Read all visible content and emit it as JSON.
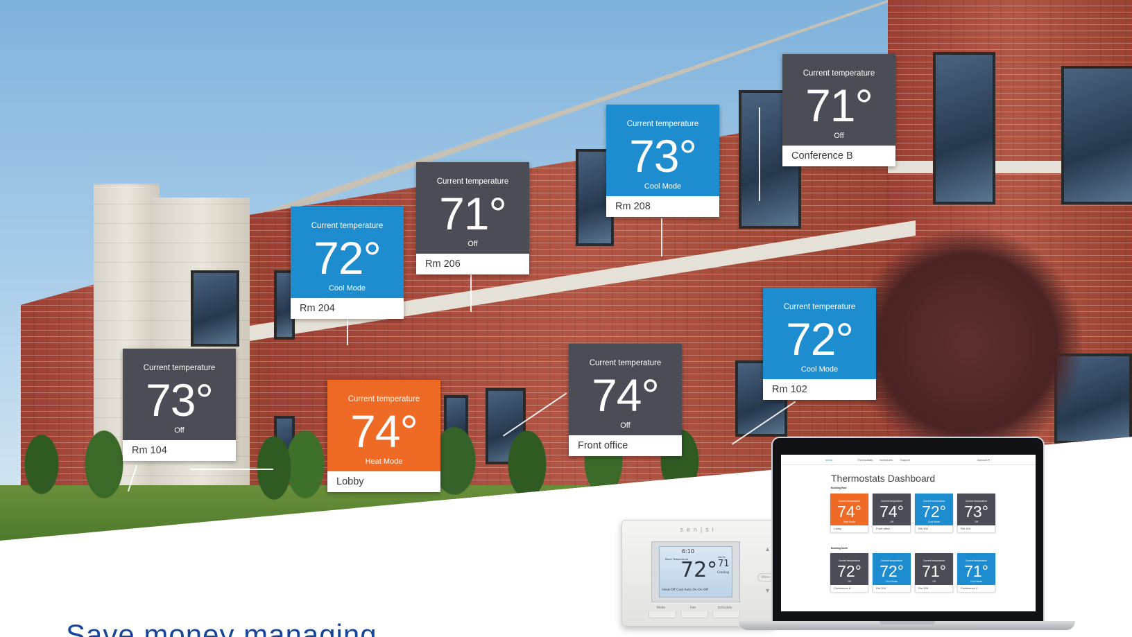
{
  "tile_caption": "Current temperature",
  "tiles": [
    {
      "temp": "73°",
      "mode": "Cool Mode",
      "name": "Rm 208",
      "status": "cool"
    },
    {
      "temp": "71°",
      "mode": "Off",
      "name": "Conference B",
      "status": "off"
    },
    {
      "temp": "71°",
      "mode": "Off",
      "name": "Rm 206",
      "status": "off"
    },
    {
      "temp": "72°",
      "mode": "Cool Mode",
      "name": "Rm 204",
      "status": "cool"
    },
    {
      "temp": "72°",
      "mode": "Cool Mode",
      "name": "Rm 102",
      "status": "cool"
    },
    {
      "temp": "73°",
      "mode": "Off",
      "name": "Rm 104",
      "status": "off"
    },
    {
      "temp": "74°",
      "mode": "Heat Mode",
      "name": "Lobby",
      "status": "heat"
    },
    {
      "temp": "74°",
      "mode": "Off",
      "name": "Front  office",
      "status": "off"
    }
  ],
  "headline": "Save money managing",
  "device": {
    "brand": "sen|si",
    "time": "6:10",
    "room_caption": "Room Temperature",
    "room_temp": "72°",
    "set_caption": "Set To",
    "set_temp": "71",
    "status": "Cooling",
    "options": "Heat Off Cool   Auto On   On  Off",
    "soft_keys": [
      "Mode",
      "Fan",
      "Schedule"
    ],
    "menu": "Menu"
  },
  "dashboard": {
    "logo": "sen|si",
    "nav": [
      "Thermostats",
      "Schedules",
      "Support"
    ],
    "account": "Account ▾",
    "title": "Thermostats Dashboard",
    "groups": [
      {
        "label": "Building East",
        "tiles": [
          {
            "temp": "74°",
            "mode": "Heat Mode",
            "name": "Lobby",
            "status": "heat"
          },
          {
            "temp": "74°",
            "mode": "Off",
            "name": "Front office",
            "status": "off"
          },
          {
            "temp": "72°",
            "mode": "Cool Mode",
            "name": "Rm 102",
            "status": "cool"
          },
          {
            "temp": "73°",
            "mode": "Off",
            "name": "Rm 104",
            "status": "off"
          }
        ]
      },
      {
        "label": "Building North",
        "tiles": [
          {
            "temp": "72°",
            "mode": "Off",
            "name": "Conference A",
            "status": "off"
          },
          {
            "temp": "72°",
            "mode": "Cool Mode",
            "name": "Rm 204",
            "status": "cool"
          },
          {
            "temp": "71°",
            "mode": "Off",
            "name": "Rm 206",
            "status": "off"
          },
          {
            "temp": "71°",
            "mode": "Cool Mode",
            "name": "Conference C",
            "status": "cool"
          }
        ]
      }
    ]
  },
  "colors": {
    "off": "#4a4d55",
    "cool": "#1e8dcf",
    "heat": "#ef6a25",
    "headline": "#17479b"
  }
}
